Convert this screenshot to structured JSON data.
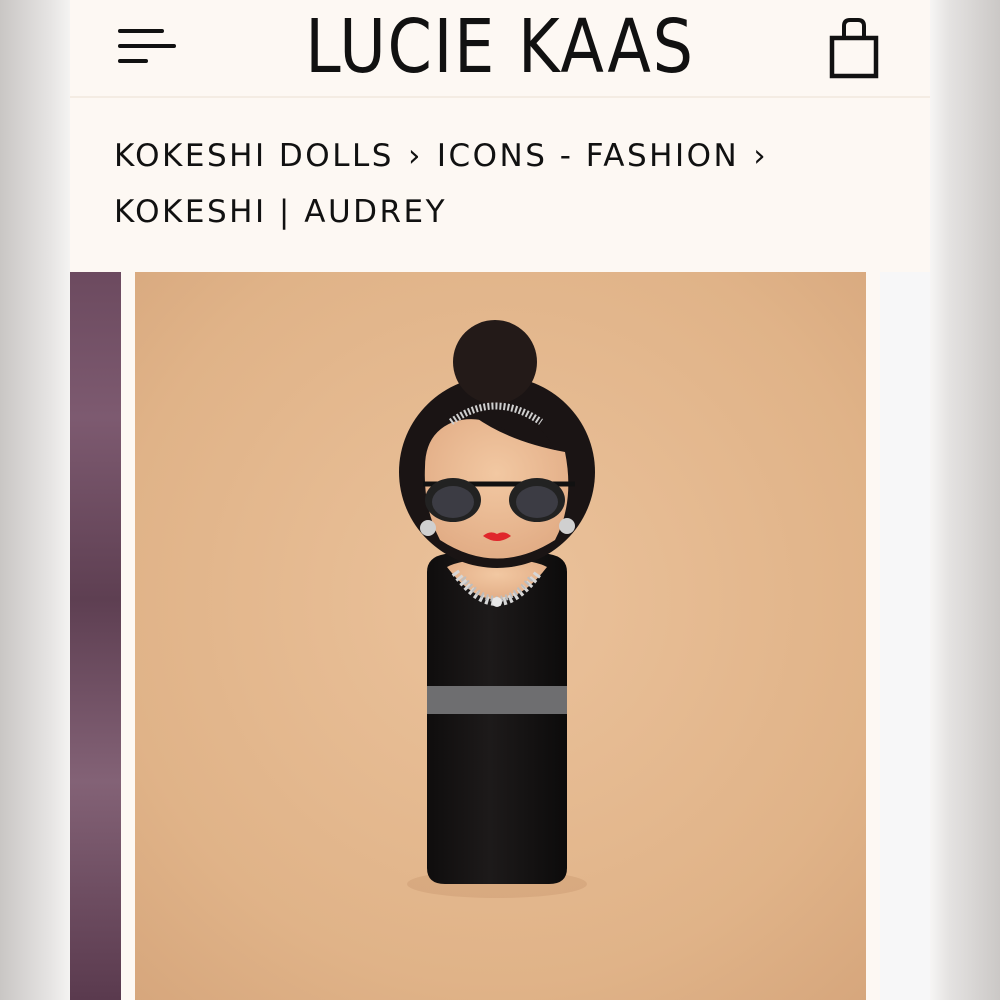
{
  "brand": {
    "logo_text": "LUCIE KAAS"
  },
  "header": {
    "menu_icon": "hamburger-menu-icon",
    "cart_icon": "shopping-bag-icon"
  },
  "breadcrumb": {
    "items": [
      {
        "label": "KOKESHI DOLLS"
      },
      {
        "label": "ICONS - FASHION"
      }
    ],
    "separator": "›",
    "current": "KOKESHI | AUDREY"
  },
  "colors": {
    "page_background": "#fdf8f3",
    "product_backdrop": "#e6b98f",
    "doll_dress": "#161414",
    "doll_belt": "#6e6e70",
    "lipstick": "#e0262b",
    "prev_slide": "#6c4a5f"
  }
}
